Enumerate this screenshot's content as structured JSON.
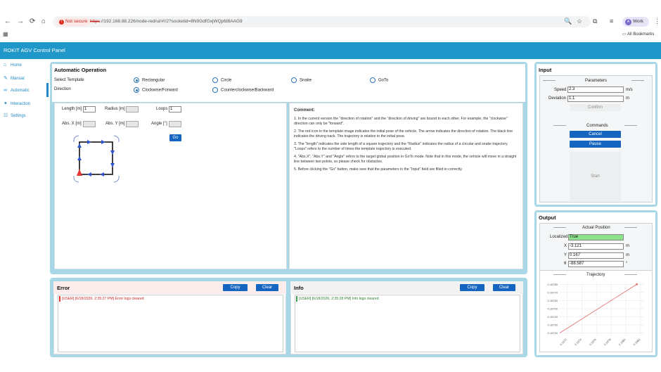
{
  "browser": {
    "not_secure": "Not secure",
    "url_strike": "https",
    "url_rest": "://192.168.88.226/node-red/ui/#!/2?socketid=8N9GdfGxjWQpfd8AAG9",
    "profile_label": "Work",
    "profile_initial": "A",
    "bookmarks_label": "All Bookmarks",
    "nav_back": "←",
    "nav_forward": "→",
    "nav_reload": "⟳",
    "nav_home": "⌂"
  },
  "app": {
    "title": "ROKIT AGV Control Panel"
  },
  "sidebar": {
    "items": [
      {
        "label": "Home",
        "icon": "home-icon",
        "glyph": "🏠"
      },
      {
        "label": "Manual",
        "icon": "wrench-icon",
        "glyph": "🔧"
      },
      {
        "label": "Automatic",
        "icon": "auto-icon",
        "glyph": "⚙"
      },
      {
        "label": "Interaction",
        "icon": "interaction-icon",
        "glyph": "✱"
      },
      {
        "label": "Settings",
        "icon": "sliders-icon",
        "glyph": "☷"
      }
    ]
  },
  "auto": {
    "title": "Automatic Operation",
    "select_template_label": "Select Template",
    "direction_label": "Direction",
    "templates": [
      "Rectangular",
      "Circle",
      "Snake",
      "GoTo"
    ],
    "selected_template": "Rectangular",
    "directions": [
      "Clockwise/Forward",
      "Counterclockwise/Backward"
    ],
    "selected_direction": "Clockwise/Forward"
  },
  "params": {
    "length_label": "Length [m]",
    "length_value": "1",
    "radius_label": "Radius [m]",
    "radius_value": "",
    "loops_label": "Loops",
    "loops_value": "1",
    "absx_label": "Abs. X [m]",
    "absx_value": "",
    "absy_label": "Abs. Y [m]",
    "absy_value": "",
    "angle_label": "Angle [°]",
    "angle_value": "",
    "go_label": "Go"
  },
  "comment": {
    "title": "Comment:",
    "lines": [
      "1. In the current version the \"direction of rotation\" and the \"direction of driving\" are bound to each other. For example, the \"clockwise\" direction can only be \"forward\".",
      "2. The red icon in the template image indicates the initial pose of the vehicle. The arrow indicates the direction of rotation. The black line indicates the driving track. The trajectory is relative to the initial pose.",
      "3. The \"length\" indicates the side length of a square trajectory and the \"Radius\" indicates the radius of a circular and snake trajectory. \"Loops\" refers to the number of times the template trajectory is executed.",
      "4. \"Abs.X\", \"Abs.Y\" and \"Angle\" refers to the target global position in GoTo mode. Note that in this mode, the vehicle will move in a straight line between two points, so please check for obstacles.",
      "5. Before clicking the \"Go\" button, make sure that the parameters in the \"Input\" field are filled in correctly."
    ]
  },
  "error": {
    "title": "Error",
    "copy_label": "Copy",
    "clear_label": "Clear",
    "log": "[USER] [6/18/2026, 2:35:27 PM] Error logs cleared"
  },
  "info": {
    "title": "Info",
    "copy_label": "Copy",
    "clear_label": "Clear",
    "log": "[USER] [6/18/2026, 2:35:28 PM] Info logs cleared"
  },
  "input": {
    "title": "Input",
    "params_header": "Parameters",
    "speed_label": "Speed",
    "speed_value": "2.3",
    "speed_unit": "m/s",
    "deviation_label": "Deviation",
    "deviation_value": "1.1",
    "deviation_unit": "m",
    "confirm_label": "Confirm",
    "commands_header": "Commands",
    "cancel_label": "Cancel",
    "pause_label": "Pause",
    "start_label": "Start",
    "dashes": "---------"
  },
  "output": {
    "title": "Output",
    "actual_header": "Actual Position",
    "localized_label": "Localized",
    "localized_value": "True",
    "x_label": "X",
    "x_value": "-3.121",
    "x_unit": "m",
    "y_label": "Y",
    "y_value": "0.167",
    "y_unit": "m",
    "theta_label": "θ",
    "theta_value": "-88.587",
    "theta_unit": "°",
    "trajectory_header": "Trajectory",
    "line_color": "#e57373"
  },
  "chart_data": {
    "type": "line",
    "title": "",
    "xlabel": "",
    "ylabel": "",
    "x_ticks": [
      "0.1672",
      "0.1674",
      "0.1676",
      "0.1678",
      "0.1680",
      "0.1682"
    ],
    "y_ticks": [
      "0.16780",
      "0.16770",
      "0.16760",
      "0.16750",
      "0.16740",
      "0.16730",
      "0.16720"
    ],
    "series": [
      {
        "x": [
          0.1671,
          0.16815
        ],
        "y": [
          0.1672,
          0.1678
        ]
      }
    ],
    "xlim": [
      0.1671,
      0.16825
    ],
    "ylim": [
      0.16717,
      0.16782
    ],
    "grid": true
  }
}
